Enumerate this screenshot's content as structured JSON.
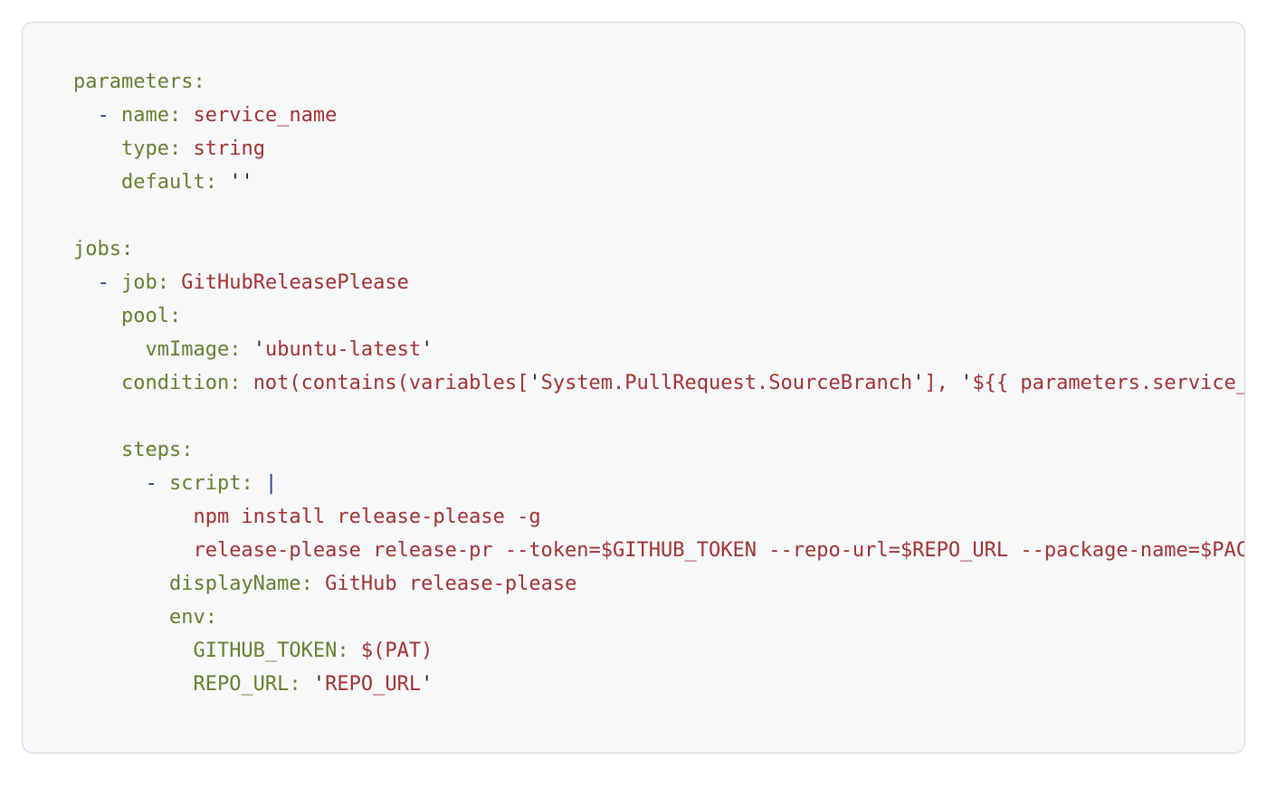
{
  "lines": [
    [
      {
        "t": "parameters:",
        "c": "tk-key"
      }
    ],
    [
      {
        "t": "  ",
        "c": ""
      },
      {
        "t": "-",
        "c": "tk-dash"
      },
      {
        "t": " ",
        "c": ""
      },
      {
        "t": "name:",
        "c": "tk-key"
      },
      {
        "t": " ",
        "c": ""
      },
      {
        "t": "service_name",
        "c": "tk-str"
      }
    ],
    [
      {
        "t": "    ",
        "c": ""
      },
      {
        "t": "type:",
        "c": "tk-key"
      },
      {
        "t": " ",
        "c": ""
      },
      {
        "t": "string",
        "c": "tk-str"
      }
    ],
    [
      {
        "t": "    ",
        "c": ""
      },
      {
        "t": "default:",
        "c": "tk-key"
      },
      {
        "t": " ",
        "c": ""
      },
      {
        "t": "''",
        "c": "tk-qt"
      }
    ],
    [],
    [
      {
        "t": "jobs:",
        "c": "tk-key"
      }
    ],
    [
      {
        "t": "  ",
        "c": ""
      },
      {
        "t": "-",
        "c": "tk-dash"
      },
      {
        "t": " ",
        "c": ""
      },
      {
        "t": "job:",
        "c": "tk-key"
      },
      {
        "t": " ",
        "c": ""
      },
      {
        "t": "GitHubReleasePlease",
        "c": "tk-str"
      }
    ],
    [
      {
        "t": "    ",
        "c": ""
      },
      {
        "t": "pool:",
        "c": "tk-key"
      }
    ],
    [
      {
        "t": "      ",
        "c": ""
      },
      {
        "t": "vmImage:",
        "c": "tk-key"
      },
      {
        "t": " ",
        "c": ""
      },
      {
        "t": "'",
        "c": "tk-qt"
      },
      {
        "t": "ubuntu-latest",
        "c": "tk-str"
      },
      {
        "t": "'",
        "c": "tk-qt"
      }
    ],
    [
      {
        "t": "    ",
        "c": ""
      },
      {
        "t": "condition:",
        "c": "tk-key"
      },
      {
        "t": " ",
        "c": ""
      },
      {
        "t": "not(contains(variables[",
        "c": "tk-str"
      },
      {
        "t": "'",
        "c": "tk-qt"
      },
      {
        "t": "System.PullRequest.SourceBranch",
        "c": "tk-str"
      },
      {
        "t": "'",
        "c": "tk-qt"
      },
      {
        "t": "], ",
        "c": "tk-str"
      },
      {
        "t": "'",
        "c": "tk-qt"
      },
      {
        "t": "${{ parameters.service_name }}",
        "c": "tk-str"
      },
      {
        "t": "'",
        "c": "tk-qt"
      },
      {
        "t": "))",
        "c": "tk-str"
      }
    ],
    [],
    [
      {
        "t": "    ",
        "c": ""
      },
      {
        "t": "steps:",
        "c": "tk-key"
      }
    ],
    [
      {
        "t": "      ",
        "c": ""
      },
      {
        "t": "-",
        "c": "tk-dash"
      },
      {
        "t": " ",
        "c": ""
      },
      {
        "t": "script:",
        "c": "tk-key"
      },
      {
        "t": " ",
        "c": ""
      },
      {
        "t": "|",
        "c": "tk-dash"
      }
    ],
    [
      {
        "t": "          ",
        "c": ""
      },
      {
        "t": "npm install release-please -g",
        "c": "tk-str"
      }
    ],
    [
      {
        "t": "          ",
        "c": ""
      },
      {
        "t": "release-please release-pr --token=$GITHUB_TOKEN --repo-url=$REPO_URL --package-name=$PACKAGE_NAME",
        "c": "tk-str"
      }
    ],
    [
      {
        "t": "        ",
        "c": ""
      },
      {
        "t": "displayName:",
        "c": "tk-key"
      },
      {
        "t": " ",
        "c": ""
      },
      {
        "t": "GitHub release-please",
        "c": "tk-str"
      }
    ],
    [
      {
        "t": "        ",
        "c": ""
      },
      {
        "t": "env:",
        "c": "tk-key"
      }
    ],
    [
      {
        "t": "          ",
        "c": ""
      },
      {
        "t": "GITHUB_TOKEN:",
        "c": "tk-key"
      },
      {
        "t": " ",
        "c": ""
      },
      {
        "t": "$(PAT)",
        "c": "tk-str"
      }
    ],
    [
      {
        "t": "          ",
        "c": ""
      },
      {
        "t": "REPO_URL:",
        "c": "tk-key"
      },
      {
        "t": " ",
        "c": ""
      },
      {
        "t": "'",
        "c": "tk-qt"
      },
      {
        "t": "REPO_URL",
        "c": "tk-str"
      },
      {
        "t": "'",
        "c": "tk-qt"
      }
    ]
  ]
}
